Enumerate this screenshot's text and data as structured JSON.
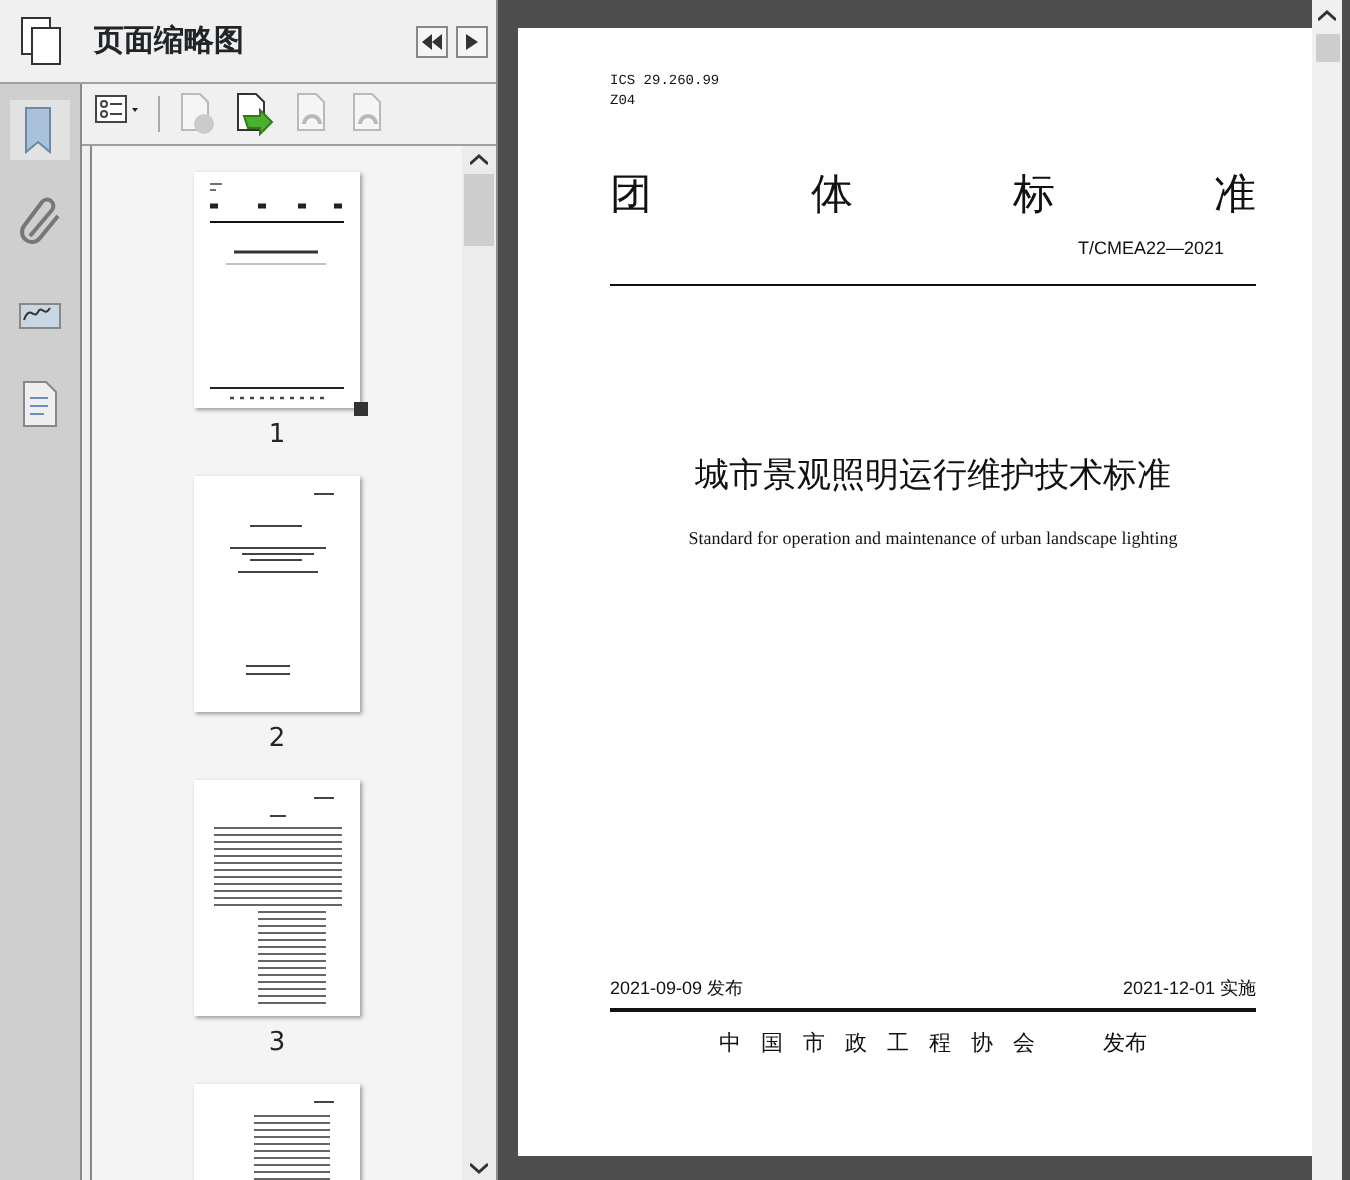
{
  "panel": {
    "title": "页面缩略图",
    "rail": [
      {
        "kind": "bookmark",
        "selected": true
      },
      {
        "kind": "attachment",
        "selected": false
      },
      {
        "kind": "signature",
        "selected": false
      },
      {
        "kind": "layers",
        "selected": false
      }
    ],
    "toolbar": [
      {
        "kind": "options",
        "disabled": false
      },
      {
        "kind": "delete",
        "disabled": true
      },
      {
        "kind": "insert",
        "disabled": false
      },
      {
        "kind": "rotate-left",
        "disabled": true
      },
      {
        "kind": "rotate-right",
        "disabled": true
      }
    ],
    "thumbnails": [
      {
        "label": "1",
        "kind": "cover",
        "current": true
      },
      {
        "label": "2",
        "kind": "title",
        "current": false
      },
      {
        "label": "3",
        "kind": "text",
        "current": false
      },
      {
        "kind": "list",
        "current": false
      }
    ]
  },
  "document": {
    "ics": "ICS 29.260.99",
    "code": "Z04",
    "header_chars": [
      "团",
      "体",
      "标",
      "准"
    ],
    "number": "T/CMEA22—2021",
    "title": "城市景观照明运行维护技术标准",
    "subtitle": "Standard for operation and maintenance of urban landscape lighting",
    "issue_date": "2021-09-09 发布",
    "effective_date": "2021-12-01 实施",
    "publisher": "中国市政工程协会",
    "publish_word": "发布"
  }
}
